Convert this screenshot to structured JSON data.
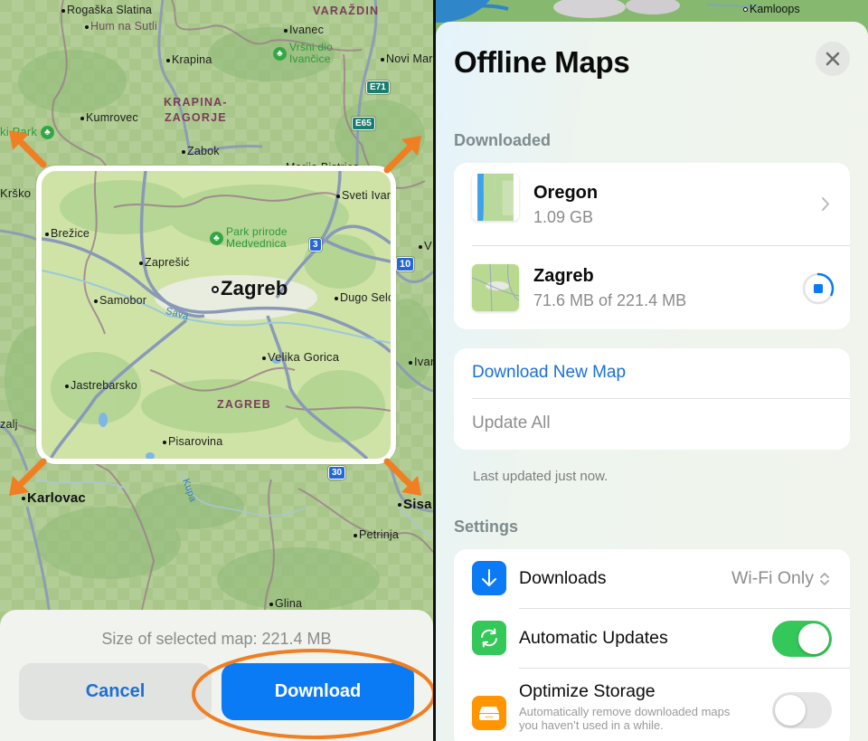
{
  "left_panel": {
    "map": {
      "labels": [
        {
          "text": "Rogaška Slatina",
          "type": "town"
        },
        {
          "text": "Hum na Sutli",
          "type": "town"
        },
        {
          "text": "VARAŽDIN",
          "type": "region"
        },
        {
          "text": "Ivanec",
          "type": "town"
        },
        {
          "text": "Vršni dio",
          "type": "park"
        },
        {
          "text": "Ivančice",
          "type": "park"
        },
        {
          "text": "Krapina",
          "type": "town"
        },
        {
          "text": "Novi Mar",
          "type": "town"
        },
        {
          "text": "KRAPINA-",
          "type": "region"
        },
        {
          "text": "ZAGORJE",
          "type": "region"
        },
        {
          "text": "Kumrovec",
          "type": "town"
        },
        {
          "text": "ki Park",
          "type": "park"
        },
        {
          "text": "Zabok",
          "type": "town"
        },
        {
          "text": "Marija Bistrica",
          "type": "town"
        },
        {
          "text": "Krško",
          "type": "town"
        },
        {
          "text": "V",
          "type": "town"
        },
        {
          "text": "Ivar",
          "type": "town"
        },
        {
          "text": "zalj",
          "type": "town"
        },
        {
          "text": "Karlovac",
          "type": "city"
        },
        {
          "text": "Sisa",
          "type": "city"
        },
        {
          "text": "Petrinja",
          "type": "town"
        },
        {
          "text": "Glina",
          "type": "town"
        },
        {
          "text": "Kupa",
          "type": "river"
        }
      ],
      "selection_labels": [
        {
          "text": "Sveti Ivan Zelina",
          "type": "town"
        },
        {
          "text": "Brežice",
          "type": "town"
        },
        {
          "text": "Park prirode",
          "type": "park"
        },
        {
          "text": "Medvednica",
          "type": "park"
        },
        {
          "text": "Zaprešić",
          "type": "town"
        },
        {
          "text": "Zagreb",
          "type": "capital"
        },
        {
          "text": "Samobor",
          "type": "town"
        },
        {
          "text": "Dugo Selo",
          "type": "town"
        },
        {
          "text": "Sava",
          "type": "river"
        },
        {
          "text": "Velika Gorica",
          "type": "town"
        },
        {
          "text": "Jastrebarsko",
          "type": "town"
        },
        {
          "text": "ZAGREB",
          "type": "region"
        },
        {
          "text": "Pisarovina",
          "type": "town"
        }
      ],
      "road_shields": [
        {
          "text": "E71",
          "kind": "european"
        },
        {
          "text": "E65",
          "kind": "european"
        },
        {
          "text": "3",
          "kind": "national"
        },
        {
          "text": "10",
          "kind": "national"
        },
        {
          "text": "30",
          "kind": "national"
        }
      ]
    },
    "bottom_sheet": {
      "size_text": "Size of selected map: 221.4 MB",
      "cancel_label": "Cancel",
      "download_label": "Download"
    },
    "annotation_color": "#f07e22"
  },
  "right_panel": {
    "background_map_label": "Kamloops",
    "title": "Offline Maps",
    "close_icon": "xmark-icon",
    "downloaded_header": "Downloaded",
    "maps": [
      {
        "name": "Oregon",
        "size": "1.09 GB",
        "status": "downloaded",
        "accessory": "chevron-right-icon"
      },
      {
        "name": "Zagreb",
        "size": "71.6 MB of 221.4 MB",
        "status": "downloading",
        "progress": 0.32,
        "accessory": "stop-download-icon"
      }
    ],
    "actions": {
      "download_new": "Download New Map",
      "update_all": "Update All"
    },
    "footnote": "Last updated just now.",
    "settings_header": "Settings",
    "settings": {
      "downloads": {
        "label": "Downloads",
        "value": "Wi-Fi Only",
        "icon": "arrow-down-icon",
        "icon_color": "#0a7bf5"
      },
      "automatic_updates": {
        "label": "Automatic Updates",
        "enabled": true,
        "icon": "sync-icon",
        "icon_color": "#34c759"
      },
      "optimize_storage": {
        "label": "Optimize Storage",
        "description_line1": "Automatically remove downloaded maps",
        "description_line2": "you haven’t used in a while.",
        "enabled": false,
        "icon": "storage-drive-icon",
        "icon_color": "#ff9500"
      }
    },
    "accent_color": "#1c6fd6"
  }
}
